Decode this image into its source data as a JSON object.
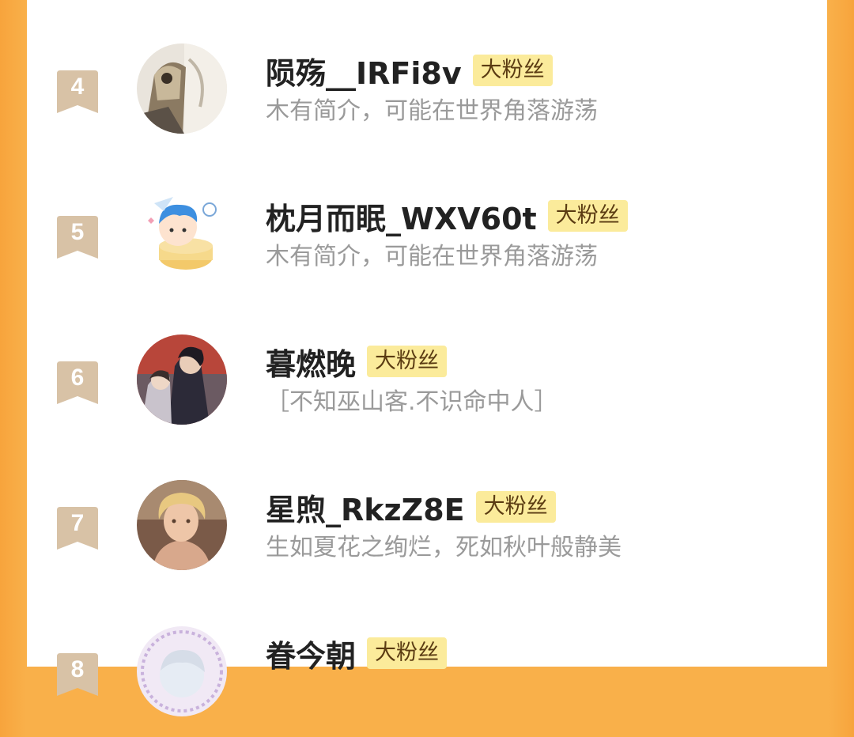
{
  "colors": {
    "background": "#f9b04a",
    "card": "#ffffff",
    "rank_ribbon": "#d8c2a6",
    "badge_bg": "#fbeb9b",
    "badge_text": "#5a3b12",
    "name_text": "#222222",
    "bio_text": "#9a9a9a"
  },
  "fans": [
    {
      "rank": "4",
      "name": "陨殇__IRFi8v",
      "badge": "大粉丝",
      "bio": "木有简介，可能在世界角落游荡",
      "avatar": "avatar-sketch-portrait"
    },
    {
      "rank": "5",
      "name": "枕月而眠_WXV60t",
      "badge": "大粉丝",
      "bio": "木有简介，可能在世界角落游荡",
      "avatar": "avatar-cartoon-blue-hair"
    },
    {
      "rank": "6",
      "name": "暮燃晚",
      "badge": "大粉丝",
      "bio": "［不知巫山客.不识命中人］",
      "avatar": "avatar-couple-red-sky"
    },
    {
      "rank": "7",
      "name": "星煦_RkzZ8E",
      "badge": "大粉丝",
      "bio": "生如夏花之绚烂，死如秋叶般静美",
      "avatar": "avatar-blonde-portrait"
    },
    {
      "rank": "8",
      "name": "眷今朝",
      "badge": "大粉丝",
      "bio": "",
      "avatar": "avatar-white-hair-lace"
    }
  ]
}
